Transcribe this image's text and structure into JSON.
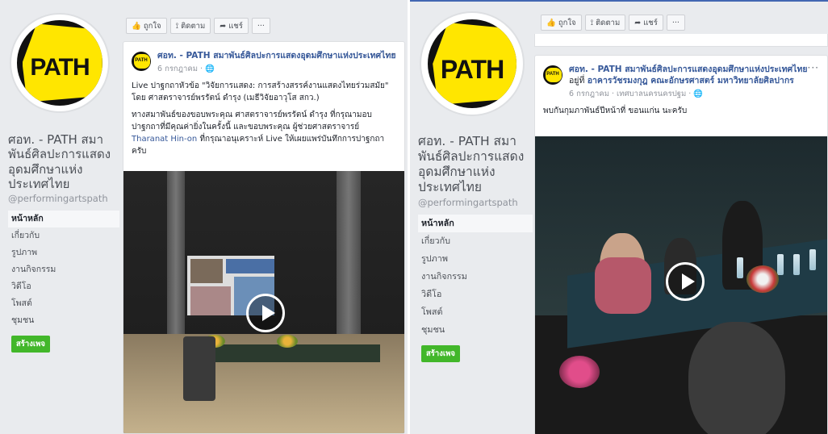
{
  "left_panel": {
    "logo_text": "PATH",
    "page_name": "ศอท. - PATH สมาพันธ์ศิลปะการแสดงอุดมศึกษาแห่งประเทศไทย",
    "handle": "@performingartspath",
    "nav": [
      {
        "label": "หน้าหลัก",
        "active": true
      },
      {
        "label": "เกี่ยวกับ"
      },
      {
        "label": "รูปภาพ"
      },
      {
        "label": "งานกิจกรรม"
      },
      {
        "label": "วิดีโอ"
      },
      {
        "label": "โพสต์"
      },
      {
        "label": "ชุมชน"
      }
    ],
    "create_page_label": "สร้างเพจ",
    "topbar": {
      "like": "ถูกใจ",
      "follow": "ติดตาม",
      "share": "แชร์",
      "more": "···"
    },
    "post": {
      "author": "ศอท. - PATH สมาพันธ์ศิลปะการแสดงอุดมศึกษาแห่งประเทศไทย",
      "meta": "6 กรกฎาคม · 🌐",
      "more": "···",
      "paragraph1": "Live ปาฐกถาหัวข้อ \"วิจัยการแสดง: การสร้างสรรค์งานแสดงไทยร่วมสมัย\" โดย ศาสตราจารย์พรรัตน์ ดำรุง (เมธีวิจัยอาวุโส สกว.)",
      "paragraph2": "ทางสมาพันธ์ของขอบพระคุณ ศาสตราจารย์พรรัตน์ ดำรุง ที่กรุณามอบปาฐกถาที่มีคุณค่ายิ่งในครั้งนี้ และขอบพระคุณ ผู้ช่วยศาสตราจารย์ ",
      "mention": "Tharanat Hin-on",
      "paragraph2_end": " ที่กรุณาอนุเคราะห์ Live ให้เผยแพร่บันทึกการปาฐกถาครับ"
    }
  },
  "right_panel": {
    "logo_text": "PATH",
    "page_name": "ศอท. - PATH สมาพันธ์ศิลปะการแสดงอุดมศึกษาแห่งประเทศไทย",
    "handle": "@performingartspath",
    "nav": [
      {
        "label": "หน้าหลัก",
        "active": true
      },
      {
        "label": "เกี่ยวกับ"
      },
      {
        "label": "รูปภาพ"
      },
      {
        "label": "งานกิจกรรม"
      },
      {
        "label": "วิดีโอ"
      },
      {
        "label": "โพสต์"
      },
      {
        "label": "ชุมชน"
      }
    ],
    "create_page_label": "สร้างเพจ",
    "topbar": {
      "like": "ถูกใจ",
      "follow": "ติดตาม",
      "share": "แชร์",
      "more": "···"
    },
    "post": {
      "author": "ศอท. - PATH สมาพันธ์ศิลปะการแสดงอุดมศึกษาแห่งประเทศไทย",
      "location_prefix": " อยู่ที่ ",
      "location": "อาคารวัชรมงกุฎ คณะอักษรศาสตร์ มหาวิทยาลัยศิลปากร",
      "meta": "6 กรกฎาคม · เทศบาลนครนครปฐม · 🌐",
      "more": "···",
      "text": "พบกันกุมภาพันธ์ปีหน้าที่ ขอนแก่น นะครับ"
    }
  }
}
